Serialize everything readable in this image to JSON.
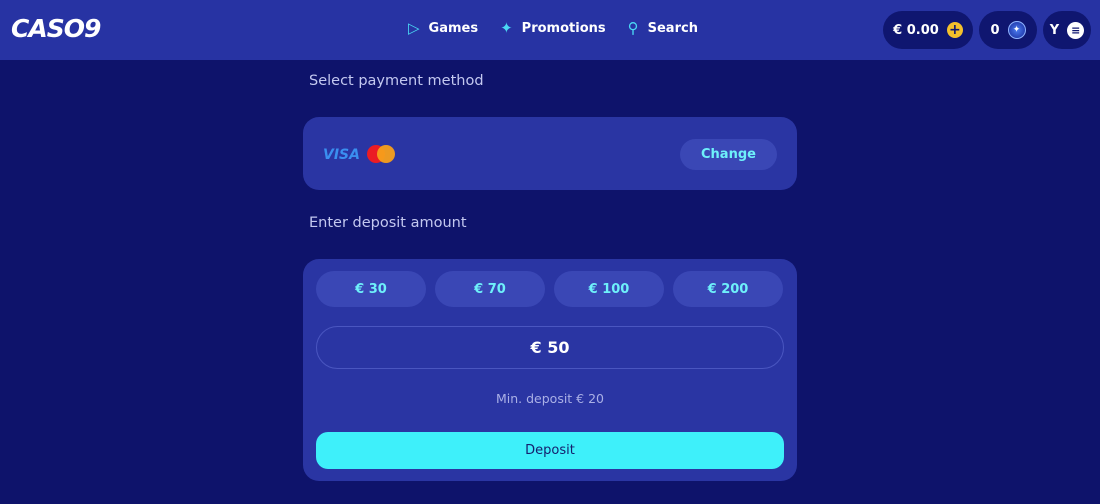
{
  "header": {
    "logo": "CASO9",
    "nav": [
      {
        "label": "Games",
        "icon": "play-icon"
      },
      {
        "label": "Promotions",
        "icon": "sparkle-icon"
      },
      {
        "label": "Search",
        "icon": "search-icon"
      }
    ],
    "balance": "€ 0.00",
    "points": "0",
    "user_initial": "Y"
  },
  "payment": {
    "label": "Select payment method",
    "brands": [
      "VISA",
      "Mastercard"
    ],
    "change": "Change"
  },
  "deposit": {
    "label": "Enter deposit amount",
    "presets": [
      "€ 30",
      "€ 70",
      "€ 100",
      "€ 200"
    ],
    "value": "€ 50",
    "min": "Min. deposit € 20",
    "button": "Deposit"
  },
  "colors": {
    "background": "#0e136b",
    "header": "#2733a3",
    "card": "#2a35a3",
    "accent": "#3ef0fa"
  }
}
